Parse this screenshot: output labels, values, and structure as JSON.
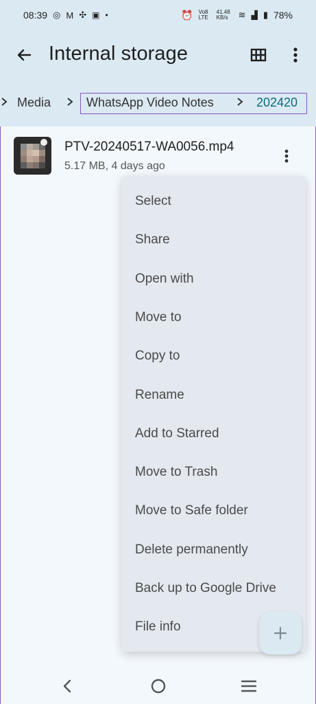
{
  "status": {
    "time": "08:39",
    "network_speed": "41.48\nKB/s",
    "network_type": "Vo8 LTE",
    "battery": "78%"
  },
  "header": {
    "title": "Internal storage",
    "back_icon": "arrow-left-icon",
    "grid_icon": "grid-view-icon",
    "more_icon": "more-vert-icon"
  },
  "breadcrumb": {
    "items": [
      "Media",
      "WhatsApp Video Notes",
      "202420"
    ]
  },
  "file": {
    "name": "PTV-20240517-WA0056.mp4",
    "meta": "5.17 MB, 4 days ago"
  },
  "menu": {
    "items": [
      "Select",
      "Share",
      "Open with",
      "Move to",
      "Copy to",
      "Rename",
      "Add to Starred",
      "Move to Trash",
      "Move to Safe folder",
      "Delete permanently",
      "Back up to Google Drive",
      "File info"
    ]
  },
  "fab": {
    "icon": "plus-icon"
  },
  "navigation": {
    "back_icon": "nav-back-icon",
    "home_icon": "home-icon",
    "recents_icon": "recents-icon"
  },
  "colors": {
    "appbar": "#dbe9f2",
    "background": "#f3f8fc",
    "menu": "#e4e8ef",
    "accent": "#0b6c7a",
    "highlight": "#8a56c2"
  }
}
